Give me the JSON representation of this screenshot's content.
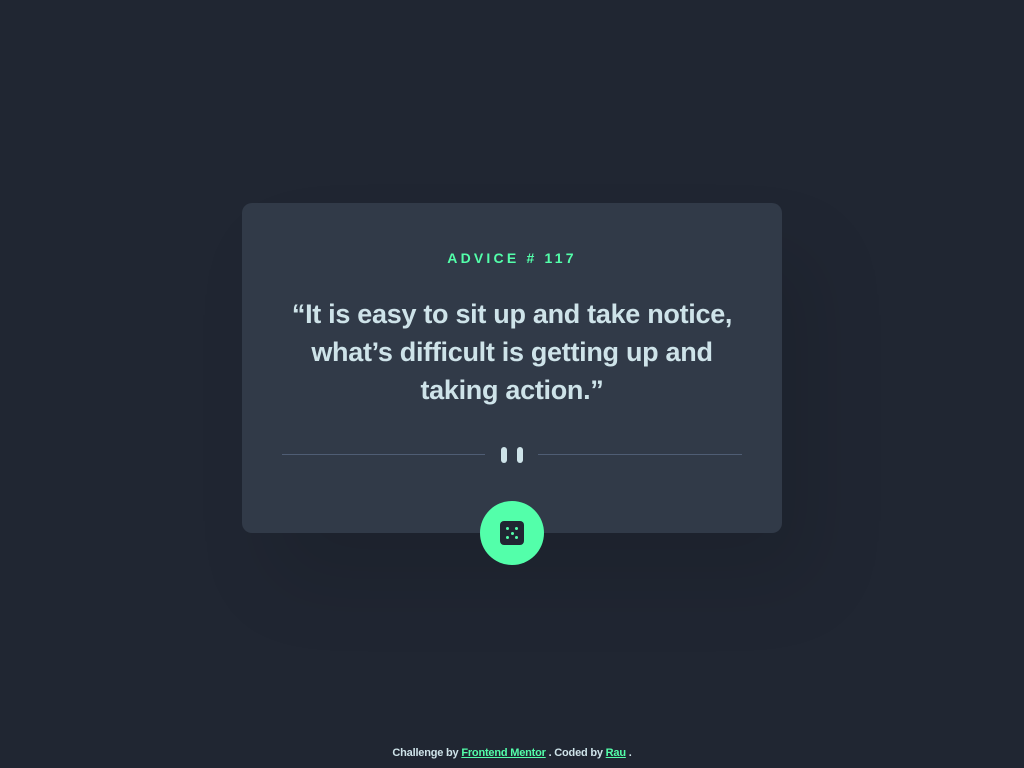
{
  "advice": {
    "label": "ADVICE # 117",
    "quote": "“It is easy to sit up and take notice, what’s difficult is getting up and taking action.”"
  },
  "icons": {
    "divider": "pause-icon",
    "button": "dice-icon"
  },
  "footer": {
    "challenge_prefix": "Challenge by",
    "challenge_link": "Frontend Mentor",
    "coded_prefix": ". Coded by",
    "coded_link": "Rau",
    "suffix": "."
  },
  "colors": {
    "background": "#202632",
    "card": "#313a48",
    "accent": "#53ffaa",
    "text": "#cee3e9",
    "divider": "#4f5d74"
  }
}
